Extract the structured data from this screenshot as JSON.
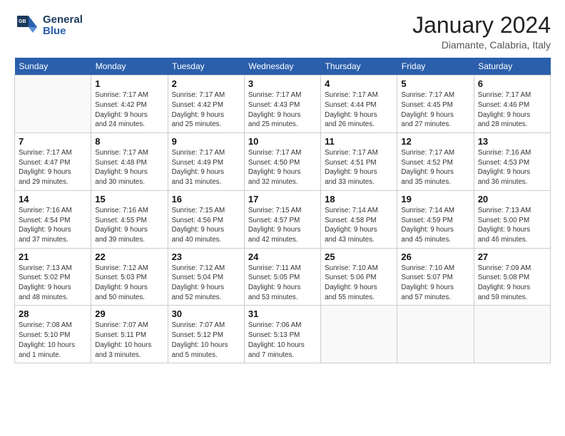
{
  "header": {
    "logo_line1": "General",
    "logo_line2": "Blue",
    "month": "January 2024",
    "location": "Diamante, Calabria, Italy"
  },
  "weekdays": [
    "Sunday",
    "Monday",
    "Tuesday",
    "Wednesday",
    "Thursday",
    "Friday",
    "Saturday"
  ],
  "weeks": [
    [
      {
        "day": "",
        "info": ""
      },
      {
        "day": "1",
        "info": "Sunrise: 7:17 AM\nSunset: 4:42 PM\nDaylight: 9 hours\nand 24 minutes."
      },
      {
        "day": "2",
        "info": "Sunrise: 7:17 AM\nSunset: 4:42 PM\nDaylight: 9 hours\nand 25 minutes."
      },
      {
        "day": "3",
        "info": "Sunrise: 7:17 AM\nSunset: 4:43 PM\nDaylight: 9 hours\nand 25 minutes."
      },
      {
        "day": "4",
        "info": "Sunrise: 7:17 AM\nSunset: 4:44 PM\nDaylight: 9 hours\nand 26 minutes."
      },
      {
        "day": "5",
        "info": "Sunrise: 7:17 AM\nSunset: 4:45 PM\nDaylight: 9 hours\nand 27 minutes."
      },
      {
        "day": "6",
        "info": "Sunrise: 7:17 AM\nSunset: 4:46 PM\nDaylight: 9 hours\nand 28 minutes."
      }
    ],
    [
      {
        "day": "7",
        "info": "Sunrise: 7:17 AM\nSunset: 4:47 PM\nDaylight: 9 hours\nand 29 minutes."
      },
      {
        "day": "8",
        "info": "Sunrise: 7:17 AM\nSunset: 4:48 PM\nDaylight: 9 hours\nand 30 minutes."
      },
      {
        "day": "9",
        "info": "Sunrise: 7:17 AM\nSunset: 4:49 PM\nDaylight: 9 hours\nand 31 minutes."
      },
      {
        "day": "10",
        "info": "Sunrise: 7:17 AM\nSunset: 4:50 PM\nDaylight: 9 hours\nand 32 minutes."
      },
      {
        "day": "11",
        "info": "Sunrise: 7:17 AM\nSunset: 4:51 PM\nDaylight: 9 hours\nand 33 minutes."
      },
      {
        "day": "12",
        "info": "Sunrise: 7:17 AM\nSunset: 4:52 PM\nDaylight: 9 hours\nand 35 minutes."
      },
      {
        "day": "13",
        "info": "Sunrise: 7:16 AM\nSunset: 4:53 PM\nDaylight: 9 hours\nand 36 minutes."
      }
    ],
    [
      {
        "day": "14",
        "info": "Sunrise: 7:16 AM\nSunset: 4:54 PM\nDaylight: 9 hours\nand 37 minutes."
      },
      {
        "day": "15",
        "info": "Sunrise: 7:16 AM\nSunset: 4:55 PM\nDaylight: 9 hours\nand 39 minutes."
      },
      {
        "day": "16",
        "info": "Sunrise: 7:15 AM\nSunset: 4:56 PM\nDaylight: 9 hours\nand 40 minutes."
      },
      {
        "day": "17",
        "info": "Sunrise: 7:15 AM\nSunset: 4:57 PM\nDaylight: 9 hours\nand 42 minutes."
      },
      {
        "day": "18",
        "info": "Sunrise: 7:14 AM\nSunset: 4:58 PM\nDaylight: 9 hours\nand 43 minutes."
      },
      {
        "day": "19",
        "info": "Sunrise: 7:14 AM\nSunset: 4:59 PM\nDaylight: 9 hours\nand 45 minutes."
      },
      {
        "day": "20",
        "info": "Sunrise: 7:13 AM\nSunset: 5:00 PM\nDaylight: 9 hours\nand 46 minutes."
      }
    ],
    [
      {
        "day": "21",
        "info": "Sunrise: 7:13 AM\nSunset: 5:02 PM\nDaylight: 9 hours\nand 48 minutes."
      },
      {
        "day": "22",
        "info": "Sunrise: 7:12 AM\nSunset: 5:03 PM\nDaylight: 9 hours\nand 50 minutes."
      },
      {
        "day": "23",
        "info": "Sunrise: 7:12 AM\nSunset: 5:04 PM\nDaylight: 9 hours\nand 52 minutes."
      },
      {
        "day": "24",
        "info": "Sunrise: 7:11 AM\nSunset: 5:05 PM\nDaylight: 9 hours\nand 53 minutes."
      },
      {
        "day": "25",
        "info": "Sunrise: 7:10 AM\nSunset: 5:06 PM\nDaylight: 9 hours\nand 55 minutes."
      },
      {
        "day": "26",
        "info": "Sunrise: 7:10 AM\nSunset: 5:07 PM\nDaylight: 9 hours\nand 57 minutes."
      },
      {
        "day": "27",
        "info": "Sunrise: 7:09 AM\nSunset: 5:08 PM\nDaylight: 9 hours\nand 59 minutes."
      }
    ],
    [
      {
        "day": "28",
        "info": "Sunrise: 7:08 AM\nSunset: 5:10 PM\nDaylight: 10 hours\nand 1 minute."
      },
      {
        "day": "29",
        "info": "Sunrise: 7:07 AM\nSunset: 5:11 PM\nDaylight: 10 hours\nand 3 minutes."
      },
      {
        "day": "30",
        "info": "Sunrise: 7:07 AM\nSunset: 5:12 PM\nDaylight: 10 hours\nand 5 minutes."
      },
      {
        "day": "31",
        "info": "Sunrise: 7:06 AM\nSunset: 5:13 PM\nDaylight: 10 hours\nand 7 minutes."
      },
      {
        "day": "",
        "info": ""
      },
      {
        "day": "",
        "info": ""
      },
      {
        "day": "",
        "info": ""
      }
    ]
  ]
}
